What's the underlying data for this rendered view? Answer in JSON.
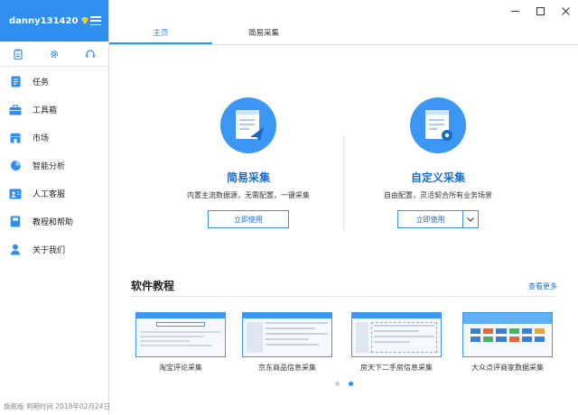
{
  "sidebar": {
    "username": "danny131420",
    "items": [
      {
        "label": "任务",
        "icon": "task-icon"
      },
      {
        "label": "工具箱",
        "icon": "toolbox-icon"
      },
      {
        "label": "市场",
        "icon": "market-icon"
      },
      {
        "label": "智能分析",
        "icon": "pie-chart-icon"
      },
      {
        "label": "人工客服",
        "icon": "support-icon"
      },
      {
        "label": "教程和帮助",
        "icon": "book-icon"
      },
      {
        "label": "关于我们",
        "icon": "person-icon"
      }
    ],
    "tools": [
      "clipboard-icon",
      "settings-icon",
      "headset-icon"
    ],
    "footer": "旗舰版 到期时间 2018年02月24日"
  },
  "tabs": [
    {
      "label": "主页",
      "active": true
    },
    {
      "label": "简易采集",
      "active": false
    }
  ],
  "cards": {
    "simple": {
      "title": "简易采集",
      "desc": "内置主流数据源，无需配置，一键采集",
      "button": "立即使用"
    },
    "custom": {
      "title": "自定义采集",
      "desc": "自由配置，灵活契合所有业务场景",
      "button": "立即使用"
    }
  },
  "tutorials": {
    "title": "软件教程",
    "more": "查看更多",
    "items": [
      {
        "caption": "淘宝评论采集"
      },
      {
        "caption": "京东商品信息采集"
      },
      {
        "caption": "房天下二手房信息采集"
      },
      {
        "caption": "大众点评商家数据采集"
      }
    ],
    "page": 2,
    "pages": 2
  },
  "colors": {
    "accent": "#2f8ef0",
    "title_blue": "#1a6fc9",
    "diamond": "#ffd21f"
  }
}
